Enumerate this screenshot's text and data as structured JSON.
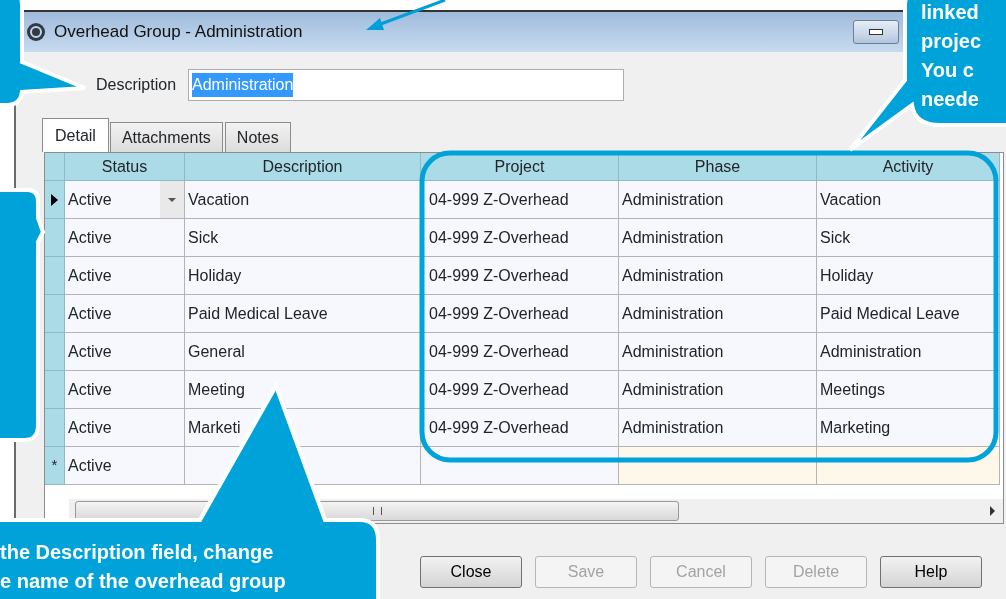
{
  "window": {
    "title": "Overhead Group - Administration"
  },
  "description": {
    "label": "Description",
    "value": "Administration"
  },
  "tabs": [
    {
      "label": "Detail",
      "selected": true
    },
    {
      "label": "Attachments",
      "selected": false
    },
    {
      "label": "Notes",
      "selected": false
    }
  ],
  "table": {
    "columns": [
      "Status",
      "Description",
      "Project",
      "Phase",
      "Activity"
    ],
    "rows": [
      {
        "kind": "data",
        "selected": true,
        "cells": [
          "Active",
          "Vacation",
          "04-999 Z-Overhead",
          "Administration",
          "Vacation"
        ]
      },
      {
        "kind": "data",
        "selected": false,
        "cells": [
          "Active",
          "Sick",
          "04-999 Z-Overhead",
          "Administration",
          "Sick"
        ]
      },
      {
        "kind": "data",
        "selected": false,
        "cells": [
          "Active",
          "Holiday",
          "04-999 Z-Overhead",
          "Administration",
          "Holiday"
        ]
      },
      {
        "kind": "data",
        "selected": false,
        "cells": [
          "Active",
          "Paid Medical Leave",
          "04-999 Z-Overhead",
          "Administration",
          "Paid Medical Leave"
        ]
      },
      {
        "kind": "data",
        "selected": false,
        "cells": [
          "Active",
          "General",
          "04-999 Z-Overhead",
          "Administration",
          "Administration"
        ]
      },
      {
        "kind": "data",
        "selected": false,
        "cells": [
          "Active",
          "Meeting",
          "04-999 Z-Overhead",
          "Administration",
          "Meetings"
        ]
      },
      {
        "kind": "data",
        "selected": false,
        "cells": [
          "Active",
          "Marketi",
          "04-999 Z-Overhead",
          "Administration",
          "Marketing"
        ]
      },
      {
        "kind": "new",
        "selected": false,
        "marker": "*",
        "cells": [
          "Active",
          "",
          "",
          "",
          ""
        ]
      }
    ]
  },
  "buttons": [
    {
      "label": "Close",
      "disabled": false
    },
    {
      "label": "Save",
      "disabled": true
    },
    {
      "label": "Cancel",
      "disabled": true
    },
    {
      "label": "Delete",
      "disabled": true
    },
    {
      "label": "Help",
      "disabled": false
    }
  ],
  "callouts": [
    {
      "kind": "top-right",
      "lines": [
        "linked",
        "projec",
        "You c",
        "neede"
      ]
    },
    {
      "kind": "bottom-left",
      "lines": [
        "the Description field, change",
        "e name of the overhead group"
      ]
    }
  ]
}
